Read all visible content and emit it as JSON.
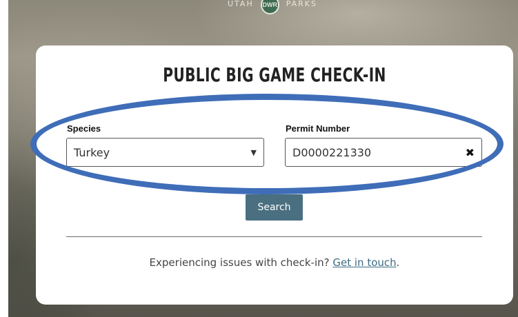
{
  "header": {
    "logo_left": "UTAH",
    "logo_right": "PARKS",
    "logo_badge": "DWR"
  },
  "form": {
    "title": "PUBLIC BIG GAME CHECK-IN",
    "species": {
      "label": "Species",
      "value": "Turkey"
    },
    "permit": {
      "label": "Permit Number",
      "value": "D0000221330"
    },
    "search_label": "Search"
  },
  "footer": {
    "text": "Experiencing issues with check-in?",
    "link": "Get in touch",
    "suffix": "."
  },
  "colors": {
    "annotation_ellipse": "#3f6db8",
    "button": "#4a6f80",
    "link": "#3f6b82"
  }
}
